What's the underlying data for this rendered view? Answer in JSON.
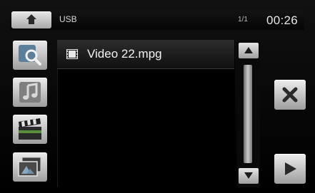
{
  "header": {
    "home_icon": "home-icon",
    "source": "USB",
    "page": "1/1",
    "clock": "00:26"
  },
  "sidebar": {
    "items": [
      {
        "name": "search",
        "icon": "search-icon"
      },
      {
        "name": "music",
        "icon": "music-note-icon"
      },
      {
        "name": "video",
        "icon": "clapperboard-icon"
      },
      {
        "name": "photo",
        "icon": "photo-icon"
      }
    ]
  },
  "file_list": {
    "items": [
      {
        "icon": "film-icon",
        "label": "Video 22.mpg"
      }
    ]
  },
  "scrollbar": {
    "up_icon": "arrow-up-icon",
    "down_icon": "arrow-down-icon"
  },
  "actions": {
    "close_icon": "close-icon",
    "play_icon": "play-icon"
  },
  "colors": {
    "background": "#000000",
    "button_light": "#e6e6e6",
    "button_dark": "#9e9e9e",
    "text": "#f2f2f2"
  }
}
